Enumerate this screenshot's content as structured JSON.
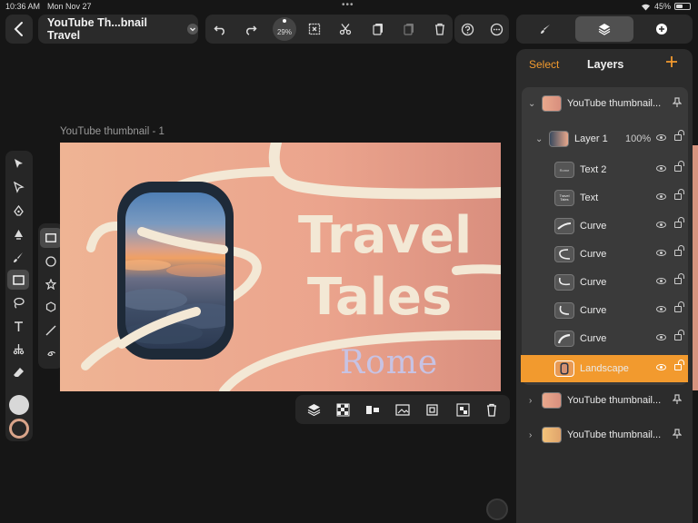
{
  "status": {
    "time": "10:36 AM",
    "date": "Mon Nov 27",
    "battery": "45%",
    "battery_level": 0.45
  },
  "header": {
    "doc_title": "YouTube Th...bnail Travel",
    "zoom": "29%"
  },
  "toolbar": {
    "icons": [
      "undo-icon",
      "redo-icon",
      "zoom-indicator",
      "select-box-icon",
      "scissors-icon",
      "copy-icon",
      "paste-icon",
      "trash-icon",
      "help-icon",
      "more-icon"
    ]
  },
  "right_tabs": [
    "brush-tab",
    "layers-tab",
    "add-tab"
  ],
  "layers_panel": {
    "select_label": "Select",
    "title": "Layers",
    "rows": [
      {
        "name": "YouTube thumbnail...",
        "type": "artboard",
        "expanded": true
      },
      {
        "name": "Layer 1",
        "opacity": "100%",
        "type": "layer",
        "expanded": true
      },
      {
        "name": "Text 2",
        "type": "text"
      },
      {
        "name": "Text",
        "type": "text"
      },
      {
        "name": "Curve",
        "type": "curve"
      },
      {
        "name": "Curve",
        "type": "curve"
      },
      {
        "name": "Curve",
        "type": "curve"
      },
      {
        "name": "Curve",
        "type": "curve"
      },
      {
        "name": "Curve",
        "type": "curve"
      },
      {
        "name": "Landscape",
        "type": "image",
        "selected": true
      },
      {
        "name": "YouTube thumbnail...",
        "type": "artboard",
        "expanded": false
      },
      {
        "name": "YouTube thumbnail...",
        "type": "artboard",
        "expanded": false
      }
    ]
  },
  "canvas": {
    "artboard_label": "YouTube thumbnail - 1",
    "title_line1": "Travel",
    "title_line2": "Tales",
    "subtitle": "Rome",
    "colors": {
      "bg_start": "#efb494",
      "bg_end": "#d98e7e",
      "curve": "#f3e8d5",
      "title": "#f3e8d5",
      "subtitle": "#c7c3e4"
    }
  },
  "thumb_text": {
    "text2": "Rome",
    "text": "Travel Tales"
  },
  "accent": "#f29a2e"
}
